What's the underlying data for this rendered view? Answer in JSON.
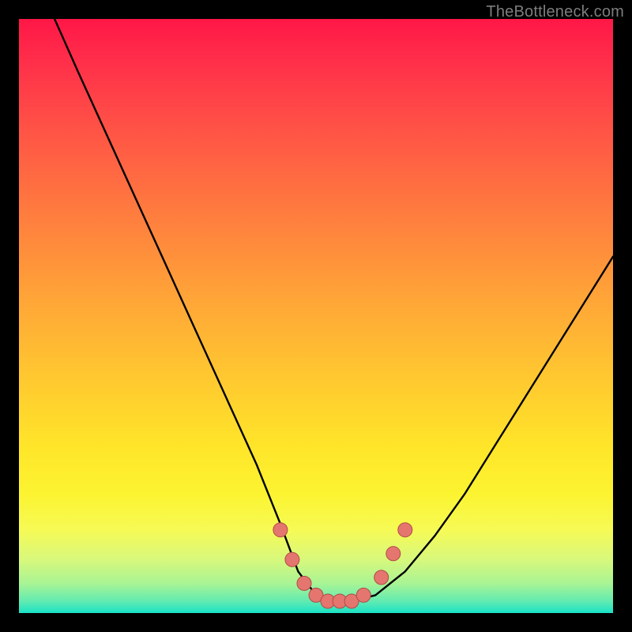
{
  "watermark": "TheBottleneck.com",
  "colors": {
    "frame": "#000000",
    "curve_stroke": "#000000",
    "marker_fill": "#e4766f",
    "marker_stroke": "#b14b45",
    "watermark_text": "#7d7d7d"
  },
  "chart_data": {
    "type": "line",
    "title": "",
    "xlabel": "",
    "ylabel": "",
    "xlim": [
      0,
      100
    ],
    "ylim": [
      0,
      100
    ],
    "note": "V-shaped bottleneck curve with flat trough; no axis ticks or numeric labels visible.",
    "series": [
      {
        "name": "bottleneck-curve",
        "x": [
          6,
          10,
          15,
          20,
          25,
          30,
          35,
          40,
          44,
          47,
          50,
          53,
          56,
          60,
          65,
          70,
          75,
          80,
          85,
          90,
          95,
          100
        ],
        "y": [
          100,
          91,
          80,
          69,
          58,
          47,
          36,
          25,
          15,
          7,
          3,
          2,
          2,
          3,
          7,
          13,
          20,
          28,
          36,
          44,
          52,
          60
        ]
      }
    ],
    "markers": [
      {
        "name": "left-upper",
        "x": 44,
        "y": 14
      },
      {
        "name": "left-mid",
        "x": 46,
        "y": 9
      },
      {
        "name": "left-lower",
        "x": 48,
        "y": 5
      },
      {
        "name": "trough-1",
        "x": 50,
        "y": 3
      },
      {
        "name": "trough-2",
        "x": 52,
        "y": 2
      },
      {
        "name": "trough-3",
        "x": 54,
        "y": 2
      },
      {
        "name": "trough-4",
        "x": 56,
        "y": 2
      },
      {
        "name": "trough-5",
        "x": 58,
        "y": 3
      },
      {
        "name": "right-lower",
        "x": 61,
        "y": 6
      },
      {
        "name": "right-mid",
        "x": 63,
        "y": 10
      },
      {
        "name": "right-upper",
        "x": 65,
        "y": 14
      }
    ]
  }
}
